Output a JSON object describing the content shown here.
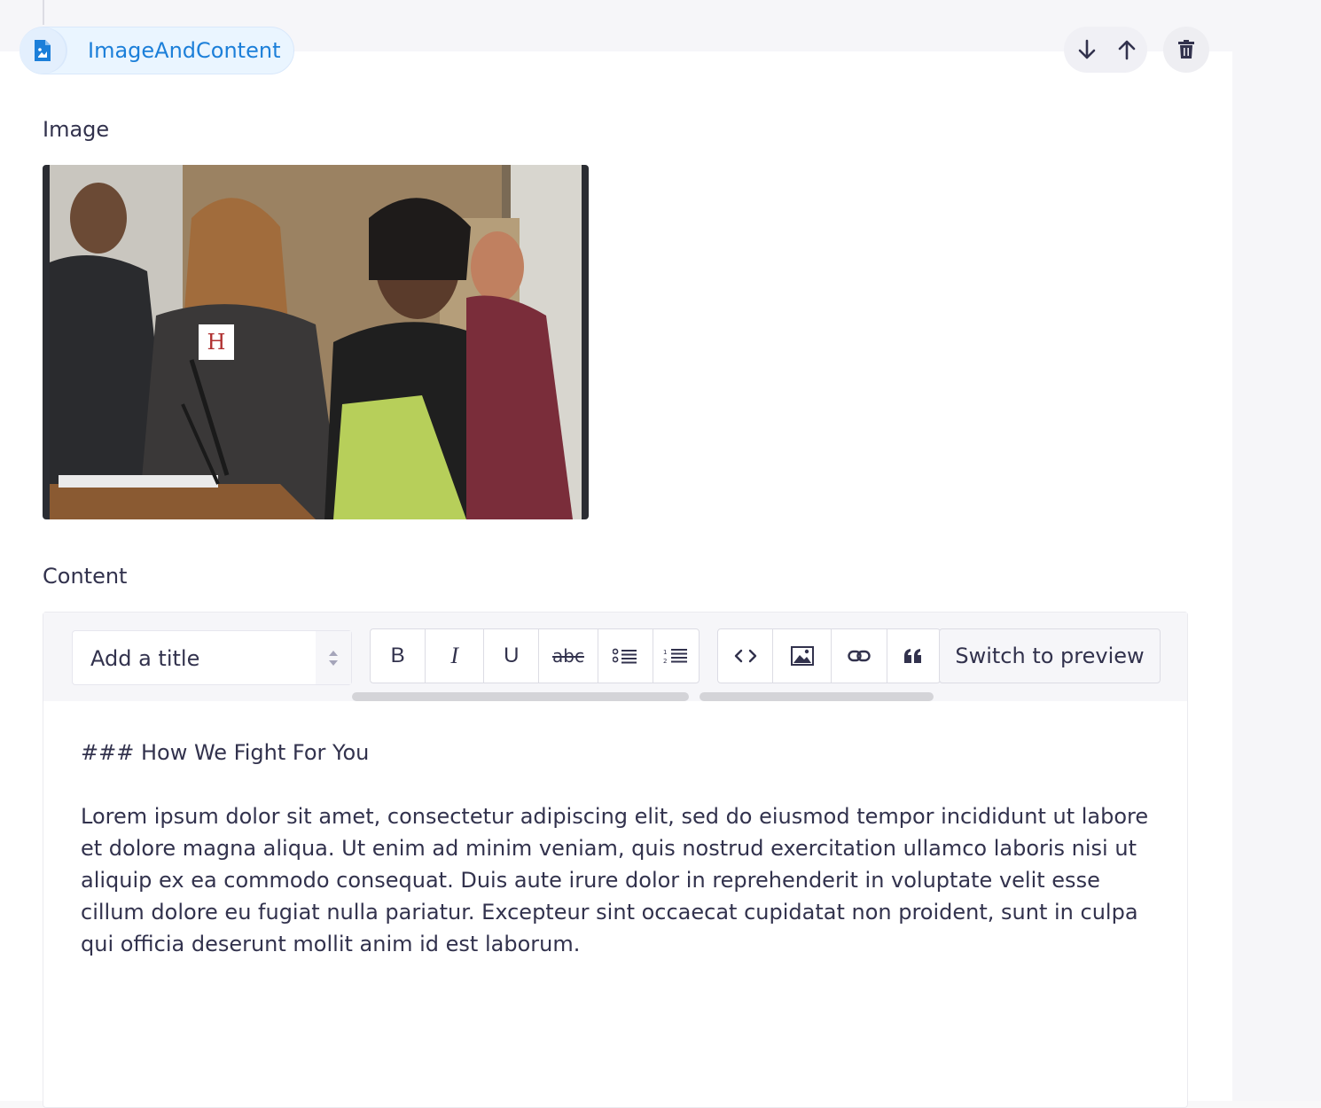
{
  "block": {
    "name": "ImageAndContent",
    "icon": "image-file-icon",
    "actions": {
      "move_down_icon": "arrow-down-icon",
      "move_up_icon": "arrow-up-icon",
      "delete_icon": "trash-icon"
    }
  },
  "fields": {
    "image_label": "Image",
    "content_label": "Content"
  },
  "editor": {
    "title_select": {
      "value": "Add a title"
    },
    "toolbar": {
      "format_buttons": [
        {
          "label": "B",
          "icon": "bold-icon"
        },
        {
          "label": "I",
          "icon": "italic-icon"
        },
        {
          "label": "U",
          "icon": "underline-icon"
        },
        {
          "label": "abc",
          "icon": "strikethrough-icon"
        },
        {
          "label": "",
          "icon": "bulleted-list-icon"
        },
        {
          "label": "",
          "icon": "numbered-list-icon"
        }
      ],
      "insert_buttons": [
        {
          "icon": "code-icon"
        },
        {
          "icon": "image-icon"
        },
        {
          "icon": "link-icon"
        },
        {
          "icon": "quote-icon"
        }
      ],
      "preview_label": "Switch to preview"
    },
    "content": {
      "heading": "### How We Fight For You",
      "paragraph": "Lorem ipsum dolor sit amet, consectetur adipiscing elit, sed do eiusmod tempor incididunt ut labore et dolore magna aliqua. Ut enim ad minim veniam, quis nostrud exercitation ullamco laboris nisi ut aliquip ex ea commodo consequat. Duis aute irure dolor in reprehenderit in voluptate velit esse cillum dolore eu fugiat nulla pariatur. Excepteur sint occaecat cupidatat non proident, sunt in culpa qui officia deserunt mollit anim id est laborum."
    }
  },
  "colors": {
    "accent": "#1c7fd9",
    "pill_bg": "#eaf5ff",
    "text": "#32324d"
  }
}
